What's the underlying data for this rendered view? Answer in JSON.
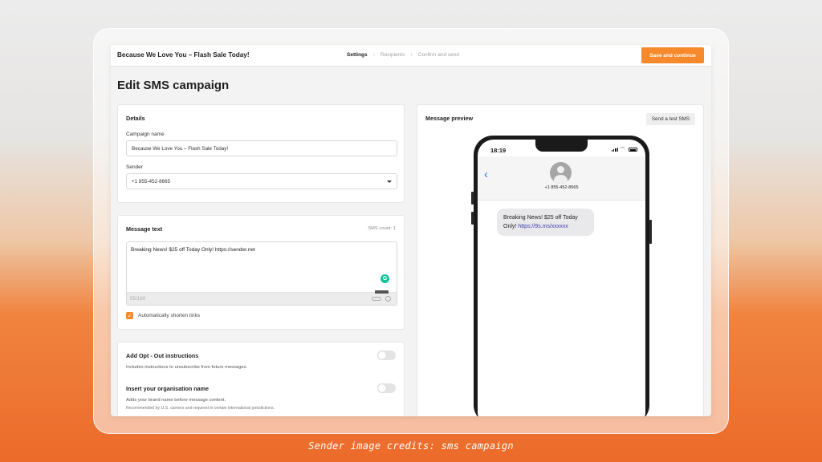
{
  "topbar": {
    "campaign_title": "Because We Love You – Flash Sale Today!",
    "steps": [
      "Settings",
      "Recipients",
      "Confirm and send"
    ],
    "save_label": "Save and continue"
  },
  "page_title": "Edit SMS campaign",
  "details": {
    "title": "Details",
    "campaign_name_label": "Campaign name",
    "campaign_name_value": "Because We Love You – Flash Sale Today!",
    "sender_label": "Sender",
    "sender_value": "+1 855-452-8665"
  },
  "message": {
    "title": "Message text",
    "sms_count": "SMS count: 1",
    "text": "Breaking News! $25 off Today Only! https://sender.net",
    "counter": "55/160",
    "shorten_label": "Automatically shorten links"
  },
  "options": {
    "optout_title": "Add Opt - Out instructions",
    "optout_desc": "Includes instructions to unsubscribe from future messages.",
    "org_title": "Insert your organisation name",
    "org_desc": "Adds your brand name before message content.",
    "org_note": "Recommended by U.S. carriers and required in certain international jurisdictions."
  },
  "preview": {
    "title": "Message preview",
    "test_label": "Send a test SMS",
    "time": "18:19",
    "contact": "+1 855-452-8665",
    "bubble_text": "Breaking News! $25 off Today Only! ",
    "bubble_link": "https://9s.ms/xxxxxx"
  },
  "credit": "Sender image credits: sms campaign",
  "colors": {
    "accent": "#f5892c",
    "link": "#3b3bb3",
    "ios_blue": "#2f7be3"
  }
}
